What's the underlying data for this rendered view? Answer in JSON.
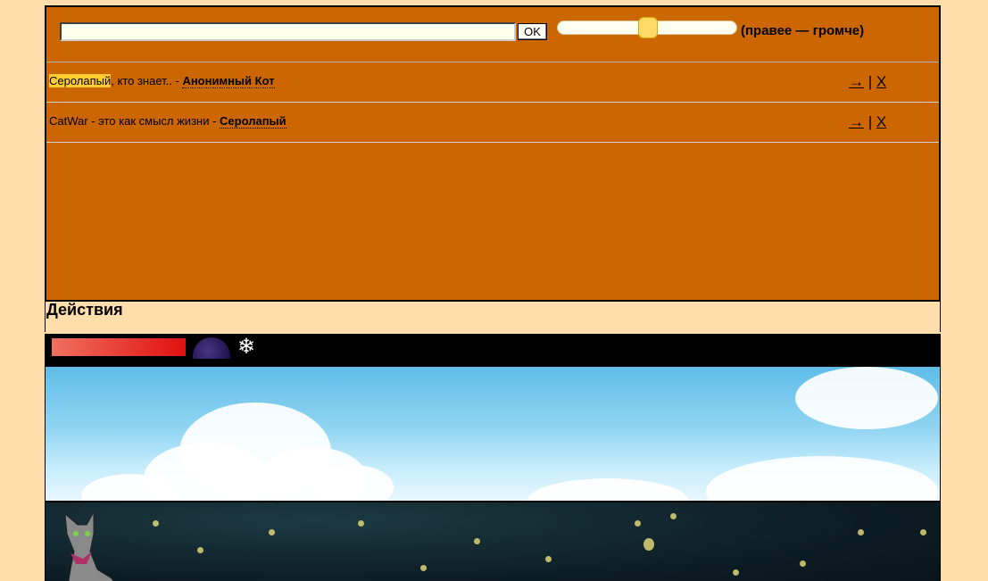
{
  "chat": {
    "input_value": "",
    "ok_label": "OK",
    "volume_label": "(правее — громче)",
    "volume_level": 0.5,
    "messages": [
      {
        "highlight": "Серолапый",
        "text": ", кто знает.. - ",
        "author": "Анонимный Кот",
        "reply": "→",
        "separator": "|",
        "delete": "X"
      },
      {
        "highlight": "",
        "text": "CatWar - это как смысл жизни - ",
        "author": "Серолапый",
        "reply": "→",
        "separator": "|",
        "delete": "X"
      }
    ]
  },
  "actions": {
    "title": "Действия"
  },
  "status": {
    "health_color": "#e01010",
    "moon_icon": "moon-icon",
    "weather_icon": "snowflake-icon",
    "weather_glyph": "❄"
  }
}
